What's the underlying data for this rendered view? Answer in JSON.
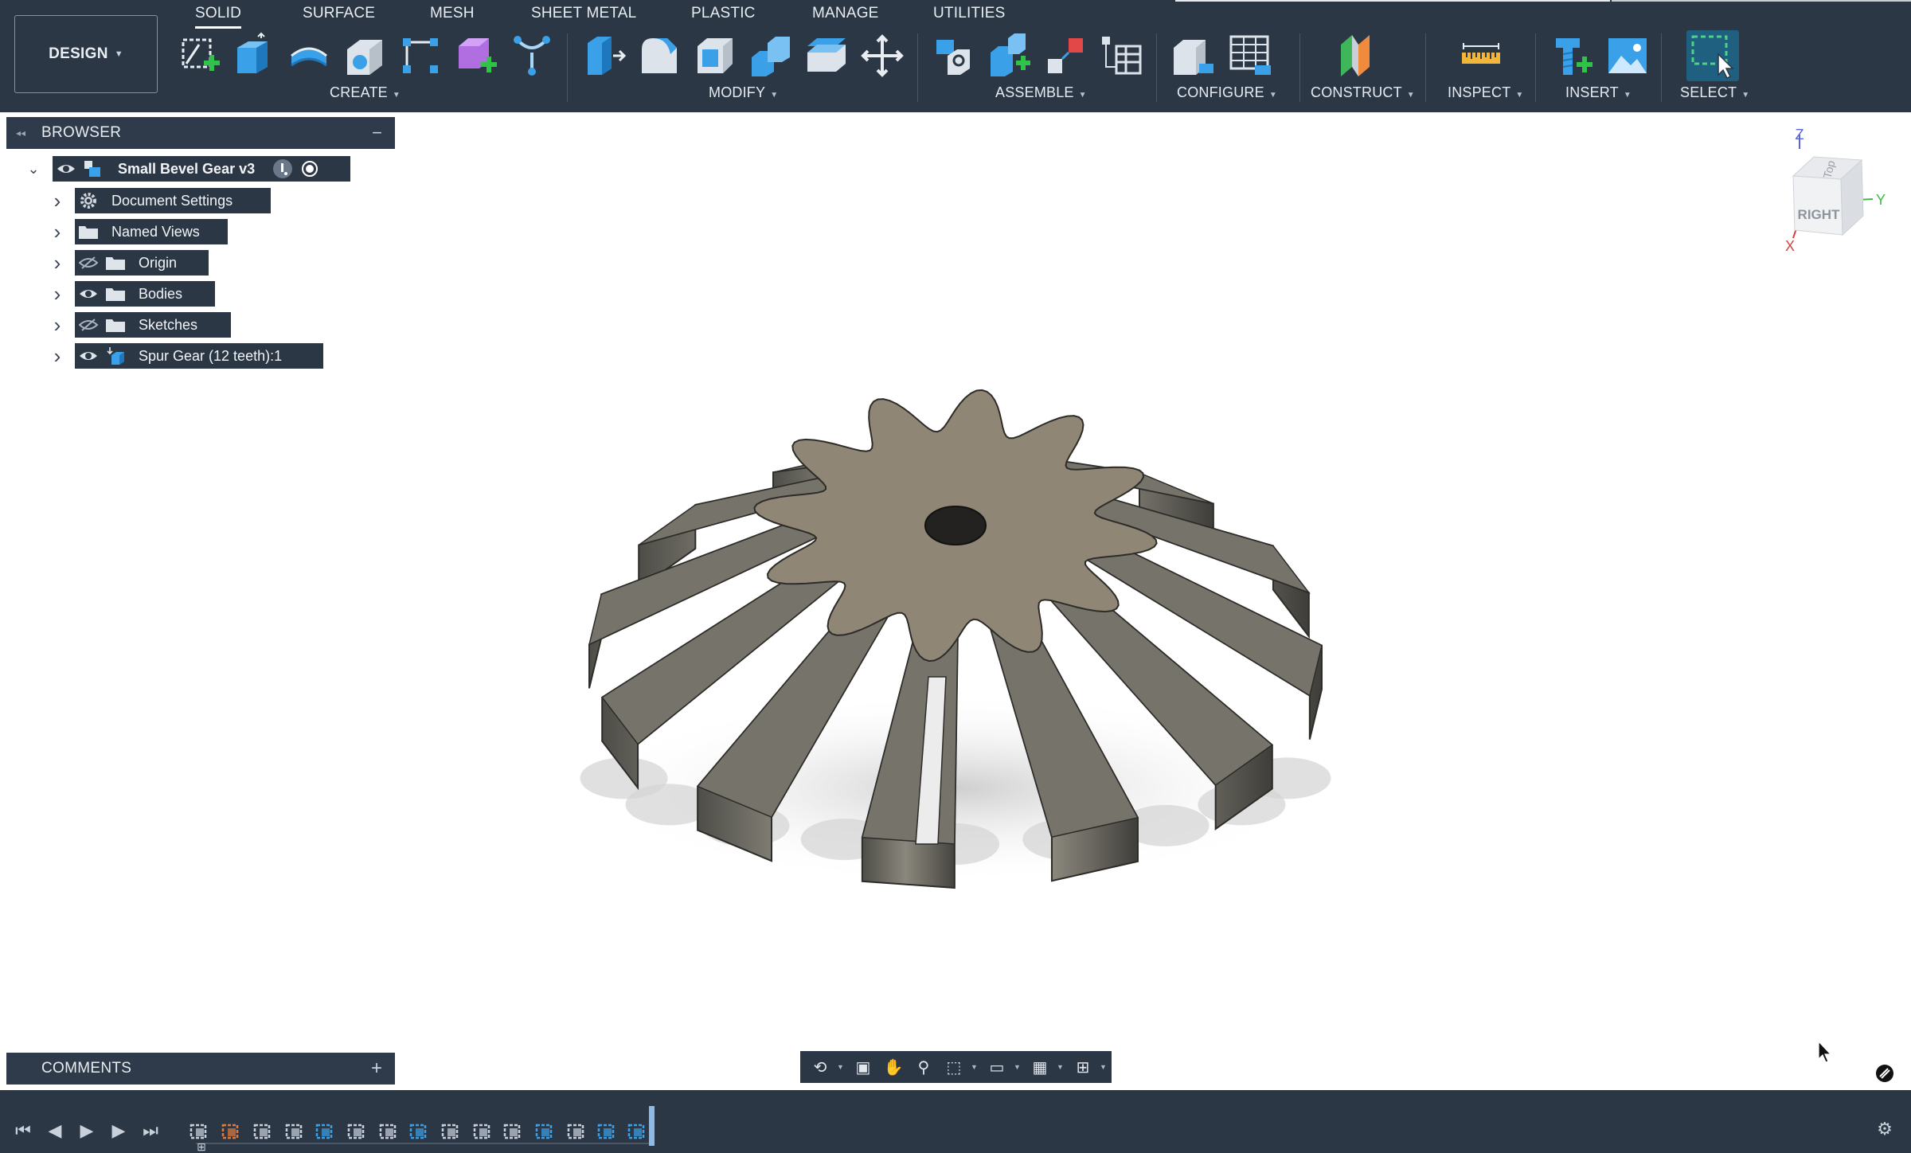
{
  "workspace": {
    "label": "DESIGN"
  },
  "tabs": [
    {
      "label": "SOLID",
      "active": true
    },
    {
      "label": "SURFACE"
    },
    {
      "label": "MESH"
    },
    {
      "label": "SHEET METAL"
    },
    {
      "label": "PLASTIC"
    },
    {
      "label": "MANAGE"
    },
    {
      "label": "UTILITIES"
    }
  ],
  "groups": {
    "create": "CREATE",
    "modify": "MODIFY",
    "assemble": "ASSEMBLE",
    "configure": "CONFIGURE",
    "construct": "CONSTRUCT",
    "inspect": "INSPECT",
    "insert": "INSERT",
    "select": "SELECT"
  },
  "browser": {
    "title": "BROWSER",
    "root": "Small Bevel Gear v3",
    "items": [
      {
        "label": "Document Settings",
        "icon": "gear-icon"
      },
      {
        "label": "Named Views",
        "icon": "folder-icon"
      },
      {
        "label": "Origin",
        "icon": "folder-icon",
        "visible": false
      },
      {
        "label": "Bodies",
        "icon": "folder-icon",
        "visible": true
      },
      {
        "label": "Sketches",
        "icon": "folder-icon",
        "visible": false
      },
      {
        "label": "Spur Gear (12 teeth):1",
        "icon": "component-icon",
        "visible": true
      }
    ]
  },
  "comments": {
    "title": "COMMENTS"
  },
  "viewcube": {
    "face_front": "RIGHT",
    "face_top": "Top",
    "axis_z": "Z",
    "axis_y": "Y",
    "axis_x": "X"
  },
  "colors": {
    "toolbar_bg": "#2c3746",
    "accent_blue": "#3aa0e8",
    "gear_face": "#8f8676",
    "gear_flank": "#5c5b55"
  }
}
